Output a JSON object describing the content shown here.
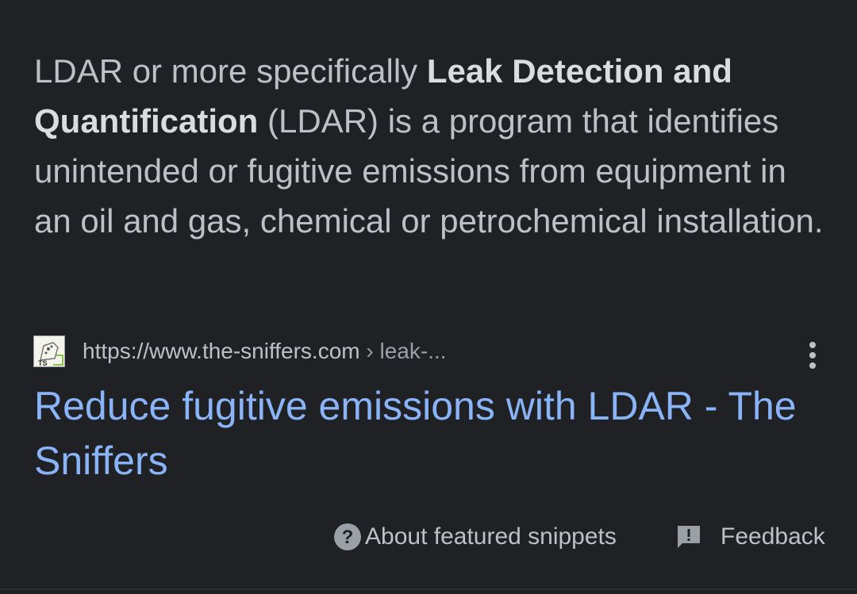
{
  "snippet": {
    "text_1": "LDAR or more specifically ",
    "bold_1": "Leak Detection and Quantification",
    "text_2": " (LDAR) is a program that identifies unintended or fugitive emissions from equipment in an oil and gas, chemical or petrochemical installation."
  },
  "source": {
    "favicon_text": "TS",
    "url": "https://www.the-sniffers.com",
    "separator": " › ",
    "path": "leak-..."
  },
  "result": {
    "title": "Reduce fugitive emissions with LDAR - The Sniffers"
  },
  "footer": {
    "about_label": "About featured snippets",
    "feedback_label": "Feedback"
  },
  "icons": {
    "favicon": "the-sniffers-logo",
    "more": "more-vert-icon",
    "help": "help-circle-icon",
    "feedback": "feedback-icon"
  },
  "colors": {
    "background": "#202124",
    "text": "#bdc1c6",
    "bold_text": "#dadce0",
    "link": "#8ab4f8"
  }
}
